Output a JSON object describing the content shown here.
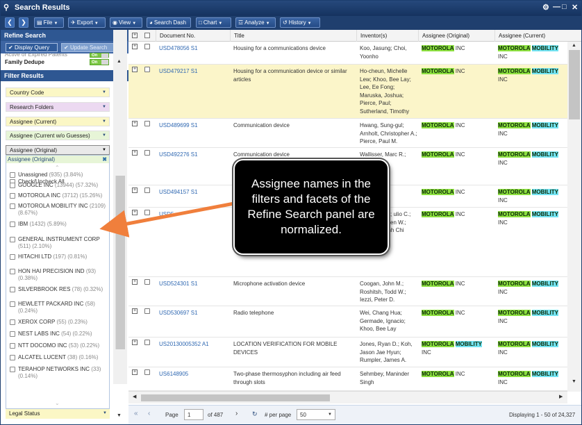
{
  "window": {
    "title": "Search Results"
  },
  "toolbar": {
    "file": "File",
    "export": "Export",
    "view": "View",
    "search_dash": "Search Dash",
    "chart": "Chart",
    "analyze": "Analyze",
    "history": "History"
  },
  "refine": {
    "title": "Refine Search",
    "display_query": "Display Query",
    "update_search": "Update Search",
    "partial_label": "Active or Expired Patents",
    "family_dedupe": "Family Dedupe",
    "toggle_on": "On"
  },
  "filter": {
    "title": "Filter Results",
    "facets": [
      "Country Code",
      "Research Folders",
      "Assignee (Current)",
      "Assignee (Current w/o Guesses)",
      "Assignee (Original)"
    ],
    "open_facet": "Assignee (Original)",
    "check_all": "Check/Uncheck All",
    "options": [
      {
        "name": "Unassigned",
        "count": "(935) (3.84%)"
      },
      {
        "name": "GOOGLE INC",
        "count": "(13944) (57.32%)"
      },
      {
        "name": "MOTOROLA INC",
        "count": "(3712) (15.26%)"
      },
      {
        "name": "MOTOROLA MOBILITY INC",
        "count": "(2109) (8.67%)"
      },
      {
        "name": "IBM",
        "count": "(1432) (5.89%)"
      },
      {
        "name": "GENERAL INSTRUMENT CORP",
        "count": "(511) (2.10%)"
      },
      {
        "name": "HITACHI LTD",
        "count": "(197) (0.81%)"
      },
      {
        "name": "HON HAI PRECISION IND",
        "count": "(93) (0.38%)"
      },
      {
        "name": "SILVERBROOK RES",
        "count": "(78) (0.32%)"
      },
      {
        "name": "HEWLETT PACKARD INC",
        "count": "(58) (0.24%)"
      },
      {
        "name": "XEROX CORP",
        "count": "(55) (0.23%)"
      },
      {
        "name": "NEST LABS INC",
        "count": "(54) (0.22%)"
      },
      {
        "name": "NTT DOCOMO INC",
        "count": "(53) (0.22%)"
      },
      {
        "name": "ALCATEL LUCENT",
        "count": "(38) (0.16%)"
      },
      {
        "name": "TERAHOP NETWORKS INC",
        "count": "(33) (0.14%)"
      }
    ],
    "legal_status": "Legal Status"
  },
  "table": {
    "headers": [
      "Document No.",
      "Title",
      "Inventor(s)",
      "Assignee (Original)",
      "Assignee (Current)"
    ],
    "rows": [
      {
        "doc": "USD478056 S1",
        "title": "Housing for a communications device",
        "inv": "Koo, Jasung; Choi, Yoonho",
        "orig": "MOTOROLA",
        "orig_rest": " INC",
        "cur": "MOTOROLA",
        "cur2": "MOBILITY",
        "cur_rest": "INC"
      },
      {
        "doc": "USD479217 S1",
        "title": "Housing for a communication device or similar articles",
        "inv": "Ho-cheun, Michelle Lew; Khoo, Bee Lay; Lee, Ee Fong; Maruska, Joshua; Pierce, Paul; Sutherland, Timothy",
        "orig": "MOTOROLA",
        "orig_rest": " INC",
        "cur": "MOTOROLA",
        "cur2": "MOBILITY",
        "cur_rest": "INC"
      },
      {
        "doc": "USD489699 S1",
        "title": "Communication device",
        "inv": "Hwang, Sung-gul; Arnholt, Christopher A.; Pierce, Paul M.",
        "orig": "MOTOROLA",
        "orig_rest": " INC",
        "cur": "MOTOROLA",
        "cur2": "MOBILITY",
        "cur_rest": "INC"
      },
      {
        "doc": "USD492276 S1",
        "title": "Communication device",
        "inv": "Wallisser, Marc R.; Colin T.; tor",
        "orig": "MOTOROLA",
        "orig_rest": " INC",
        "cur": "MOTOROLA",
        "cur2": "MOBILITY",
        "cur_rest": "INC"
      },
      {
        "doc": "USD494157 S1",
        "title": "",
        "inv": "d L.; avid P.",
        "orig": "MOTOROLA",
        "orig_rest": " INC",
        "cur": "MOTOROLA",
        "cur2": "MOBILITY",
        "cur_rest": "INC"
      },
      {
        "doc": "USD5",
        "title": "",
        "inv": "co; onald W.; ulio C.; ong; r; Carsten W.; Nguyen, Minh Chi",
        "orig": "MOTOROLA",
        "orig_rest": " INC",
        "cur": "MOTOROLA",
        "cur2": "MOBILITY",
        "cur_rest": "INC"
      },
      {
        "doc": "USD524301 S1",
        "title": "Microphone activation device",
        "inv": "Coogan, John M.; Roshitsh, Todd W.; Iezzi, Peter D.",
        "orig": "MOTOROLA",
        "orig_rest": " INC",
        "cur": "MOTOROLA",
        "cur2": "MOBILITY",
        "cur_rest": "INC"
      },
      {
        "doc": "USD530697 S1",
        "title": "Radio telephone",
        "inv": "Wei, Chang Hua; Germade, Ignacio; Khoo, Bee Lay",
        "orig": "MOTOROLA",
        "orig_rest": " INC",
        "cur": "MOTOROLA",
        "cur2": "MOBILITY",
        "cur_rest": "INC"
      },
      {
        "doc": "US20130005352 A1",
        "title": "LOCATION VERIFICATION FOR MOBILE DEVICES",
        "inv": "Jones, Ryan D.; Koh, Jason Jae Hyun; Rumpler, James A.",
        "orig": "MOTOROLA",
        "orig2": "MOBILITY",
        "orig_rest": "INC",
        "cur": "MOTOROLA",
        "cur2": "MOBILITY",
        "cur_rest": "INC"
      },
      {
        "doc": "US6148905",
        "title": "Two-phase thermosyphon including air feed through slots",
        "inv": "Sehmbey, Maninder Singh",
        "orig": "MOTOROLA",
        "orig_rest": " INC",
        "cur": "MOTOROLA",
        "cur2": "MOBILITY",
        "cur_rest": "INC"
      }
    ]
  },
  "pager": {
    "page_label": "Page",
    "page_value": "1",
    "of": "of 487",
    "per_page_label": "# per page",
    "per_page_value": "50",
    "status": "Displaying 1 - 50 of 24,327"
  },
  "callout": "Assignee names in the filters and facets of the Refine Search panel are normalized."
}
